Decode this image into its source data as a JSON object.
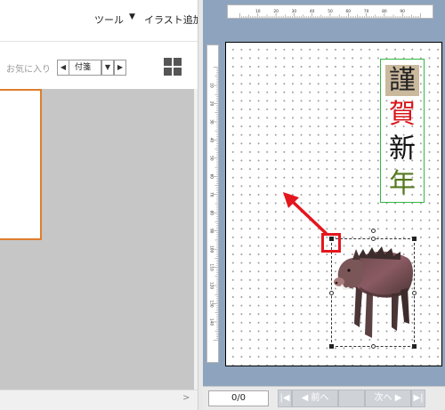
{
  "menu": {
    "tool": "ツール",
    "dropdown_arrow": "▼",
    "add_illust": "イラスト追加"
  },
  "favorites": {
    "label": "お気に入り",
    "prev_glyph": "◀",
    "value": "付箋",
    "dropdown_glyph": "▼",
    "next_glyph": "▶"
  },
  "left_scroll_chevron": ">",
  "ruler": {
    "top_ticks": [
      "10",
      "20",
      "30",
      "40",
      "50",
      "60",
      "70",
      "80",
      "90"
    ],
    "left_ticks": [
      "10",
      "20",
      "30",
      "40",
      "50",
      "60",
      "70",
      "80",
      "90",
      "100",
      "110",
      "120",
      "130",
      "140"
    ]
  },
  "greeting": {
    "chars": [
      "謹",
      "賀",
      "新",
      "年"
    ],
    "colors": [
      "#222222",
      "#d8141a",
      "#111111",
      "#567a1d"
    ]
  },
  "colors": {
    "selection_border": "#e07d2c",
    "annotation_red": "#e4161d",
    "textbox_border": "#34b844",
    "workspace_bg": "#8ea3bd"
  },
  "icons": {
    "thumbnail_grid": "grid-icon",
    "boar_illustration": "boar-image",
    "annotation_arrow": "arrow-icon"
  },
  "status": {
    "page_counter": "0/0",
    "first": "|◀",
    "prev": "◀ 前へ",
    "next": "次へ ▶",
    "last": "▶|"
  }
}
